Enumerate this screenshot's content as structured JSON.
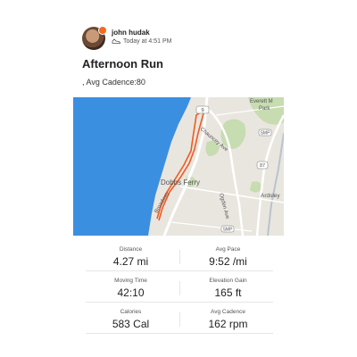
{
  "activity": {
    "athlete_name": "john hudak",
    "timestamp": "Today at 4:51 PM",
    "title": "Afternoon Run",
    "subtitle": ", Avg Cadence:80"
  },
  "map": {
    "labels": {
      "route_9": "9",
      "everett": "Everett M",
      "park": "Park",
      "chauncey": "Chauncey Ave",
      "dobbs_ferry": "Dobbs Ferry",
      "broadway": "Broadway",
      "ogden": "Ogden Ave",
      "ardsley": "Ardsley",
      "smp_top": "SMP",
      "smp_bottom": "SMP",
      "i87": "87"
    },
    "colors": {
      "water": "#3b8fe0",
      "land": "#e9e6df",
      "park": "#c7dcb0",
      "route": "#f05a23",
      "road": "#ffffff"
    }
  },
  "stats": [
    {
      "label": "Distance",
      "value": "4.27 mi"
    },
    {
      "label": "Avg Pace",
      "value": "9:52 /mi"
    },
    {
      "label": "Moving Time",
      "value": "42:10"
    },
    {
      "label": "Elevation Gain",
      "value": "165 ft"
    },
    {
      "label": "Calories",
      "value": "583 Cal"
    },
    {
      "label": "Avg Cadence",
      "value": "162 rpm"
    }
  ]
}
